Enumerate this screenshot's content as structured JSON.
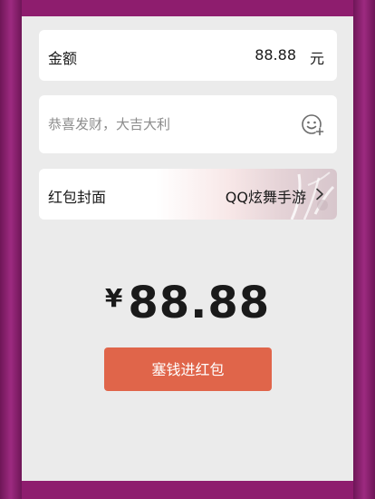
{
  "amount": {
    "label": "金额",
    "value": "88.88",
    "unit": "元"
  },
  "greeting": {
    "placeholder": "恭喜发财，大吉大利",
    "emoji_icon": "emoji-add-icon"
  },
  "cover": {
    "label": "红包封面",
    "value": "QQ炫舞手游",
    "chevron_icon": "chevron-right-icon"
  },
  "total": {
    "currency_symbol": "¥",
    "value": "88.88"
  },
  "submit": {
    "label": "塞钱进红包"
  },
  "colors": {
    "frame": "#8e1d6e",
    "panel_bg": "#ebebeb",
    "card_bg": "#ffffff",
    "button_bg": "#e0654a"
  }
}
